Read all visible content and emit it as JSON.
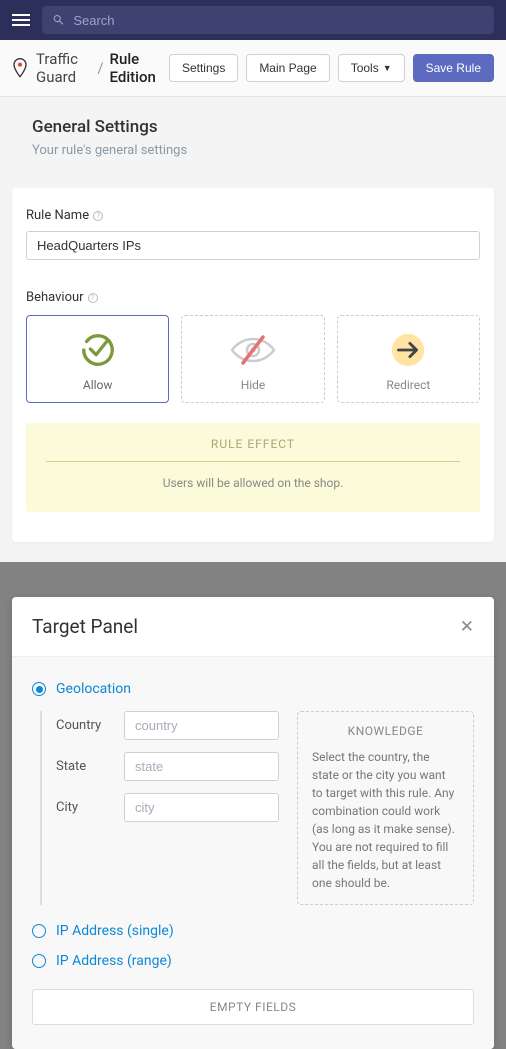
{
  "topbar": {
    "search_placeholder": "Search"
  },
  "breadcrumb": {
    "root": "Traffic Guard",
    "sep": "/",
    "current": "Rule Edition"
  },
  "header_buttons": {
    "settings": "Settings",
    "main_page": "Main Page",
    "tools": "Tools",
    "save": "Save Rule"
  },
  "section": {
    "title": "General Settings",
    "subtitle": "Your rule's general settings"
  },
  "rule_name": {
    "label": "Rule Name",
    "value": "HeadQuarters IPs"
  },
  "behaviour": {
    "label": "Behaviour",
    "options": [
      {
        "key": "allow",
        "label": "Allow",
        "selected": true
      },
      {
        "key": "hide",
        "label": "Hide",
        "selected": false
      },
      {
        "key": "redirect",
        "label": "Redirect",
        "selected": false
      }
    ],
    "effect_title": "RULE EFFECT",
    "effect_text": "Users will be allowed on the shop."
  },
  "modal": {
    "title": "Target Panel",
    "geolocation": {
      "label": "Geolocation",
      "checked": true,
      "country_label": "Country",
      "country_placeholder": "country",
      "state_label": "State",
      "state_placeholder": "state",
      "city_label": "City",
      "city_placeholder": "city"
    },
    "knowledge": {
      "title": "KNOWLEDGE",
      "body": "Select the country, the state or the city you want to target with this rule. Any combination could work (as long as it make sense). You are not required to fill all the fields, but at least one should be."
    },
    "ip_single": {
      "label": "IP Address (single)",
      "checked": false
    },
    "ip_range": {
      "label": "IP Address (range)",
      "checked": false
    },
    "empty_title": "EMPTY FIELDS"
  }
}
